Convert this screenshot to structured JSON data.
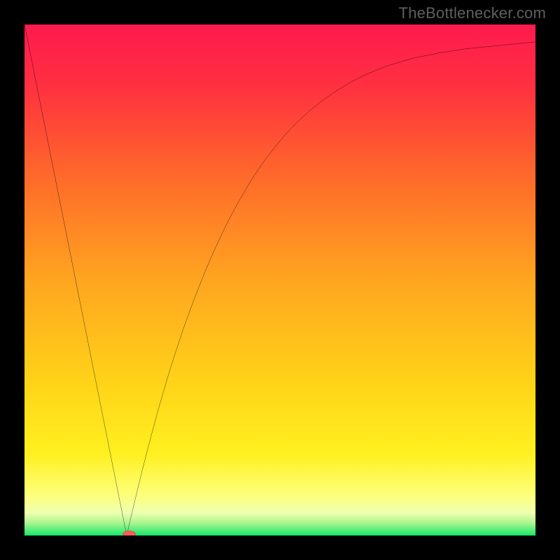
{
  "watermark": {
    "text": "TheBottlenecker.com"
  },
  "chart_data": {
    "type": "line",
    "title": "",
    "xlabel": "",
    "ylabel": "",
    "xlim": [
      0,
      100
    ],
    "ylim": [
      0,
      100
    ],
    "grid": false,
    "legend": false,
    "x": [
      0,
      1,
      2,
      3,
      4,
      5,
      6,
      7,
      8,
      9,
      10,
      11,
      12,
      13,
      14,
      15,
      16,
      17,
      18,
      19,
      20,
      21,
      22,
      23,
      24,
      25,
      26,
      27,
      28,
      29,
      30,
      31,
      32,
      33,
      34,
      35,
      36,
      37,
      38,
      39,
      40,
      41,
      42,
      43,
      44,
      45,
      46,
      47,
      48,
      49,
      50,
      51,
      52,
      53,
      54,
      55,
      56,
      57,
      58,
      59,
      60,
      61,
      62,
      63,
      64,
      65,
      66,
      67,
      68,
      69,
      70,
      71,
      72,
      73,
      74,
      75,
      76,
      77,
      78,
      79,
      80,
      81,
      82,
      83,
      84,
      85,
      86,
      87,
      88,
      89,
      90,
      91,
      92,
      93,
      94,
      95,
      96,
      97,
      98,
      99,
      100
    ],
    "values": [
      100.0,
      95.0,
      90.0,
      85.0,
      80.0,
      75.0,
      70.0,
      65.0,
      60.0,
      55.0,
      50.0,
      45.0,
      40.0,
      35.0,
      30.0,
      25.0,
      20.0,
      15.0,
      10.0,
      5.0,
      0.0,
      4.3,
      8.5,
      12.6,
      16.5,
      20.3,
      24.0,
      27.5,
      30.9,
      34.1,
      37.2,
      40.2,
      43.0,
      45.7,
      48.3,
      50.8,
      53.2,
      55.5,
      57.7,
      59.8,
      61.8,
      63.7,
      65.5,
      67.2,
      68.9,
      70.5,
      72.0,
      73.4,
      74.7,
      76.0,
      77.2,
      78.4,
      79.5,
      80.5,
      81.5,
      82.4,
      83.3,
      84.1,
      84.9,
      85.6,
      86.3,
      87.0,
      87.6,
      88.2,
      88.8,
      89.3,
      89.8,
      90.3,
      90.7,
      91.1,
      91.5,
      91.9,
      92.2,
      92.5,
      92.8,
      93.1,
      93.4,
      93.6,
      93.8,
      94.0,
      94.2,
      94.4,
      94.6,
      94.7,
      94.9,
      95.0,
      95.2,
      95.3,
      95.4,
      95.5,
      95.6,
      95.7,
      95.8,
      95.9,
      96.0,
      96.1,
      96.2,
      96.3,
      96.4,
      96.5,
      96.6
    ],
    "gradient_stops": [
      {
        "offset": 0.0,
        "color": "#ff1a4f"
      },
      {
        "offset": 0.12,
        "color": "#ff3040"
      },
      {
        "offset": 0.3,
        "color": "#ff6a2a"
      },
      {
        "offset": 0.5,
        "color": "#ffa520"
      },
      {
        "offset": 0.7,
        "color": "#ffd318"
      },
      {
        "offset": 0.84,
        "color": "#fff020"
      },
      {
        "offset": 0.92,
        "color": "#fdff7a"
      },
      {
        "offset": 0.955,
        "color": "#f0ffb0"
      },
      {
        "offset": 0.975,
        "color": "#aef590"
      },
      {
        "offset": 1.0,
        "color": "#14e86a"
      }
    ],
    "marker": {
      "x": 20.5,
      "y": 0.3,
      "rx": 1.2,
      "ry": 0.6,
      "color": "#ff5a5a"
    }
  }
}
